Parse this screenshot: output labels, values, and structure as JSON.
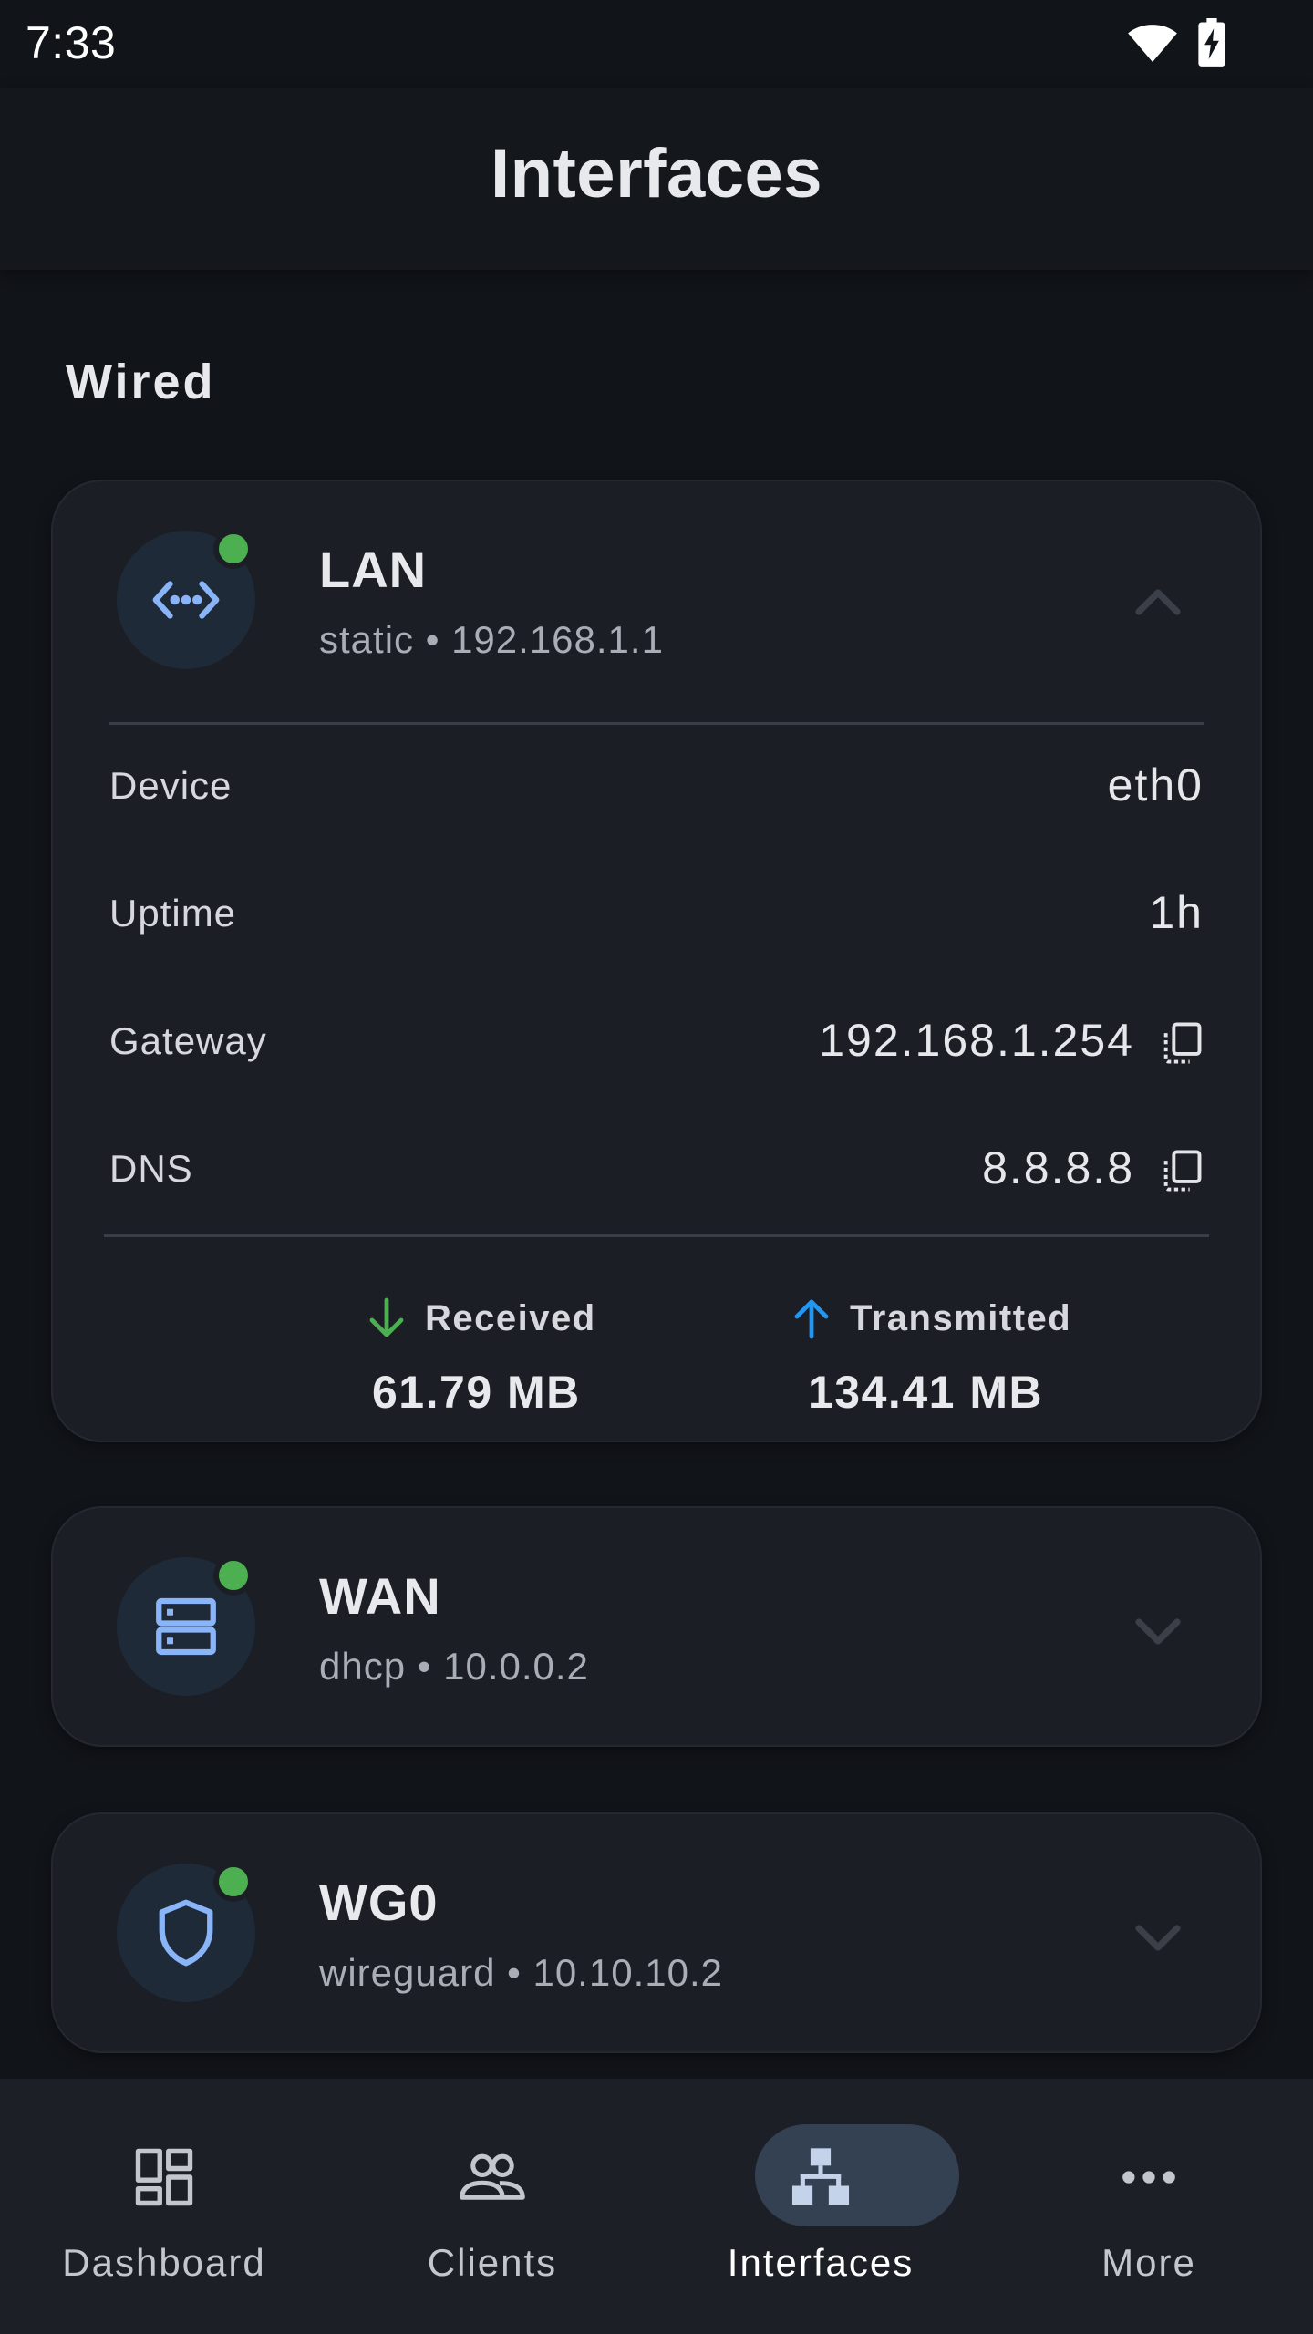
{
  "status_bar": {
    "time": "7:33",
    "wifi_icon": "wifi-icon",
    "battery_icon": "battery-charging-icon"
  },
  "app_bar": {
    "title": "Interfaces"
  },
  "section": {
    "title": "Wired"
  },
  "colors": {
    "online": "#4caf50",
    "received": "#4caf50",
    "transmitted": "#2196f3",
    "icon_accent": "#8ab4f8",
    "active_pill": "#344152"
  },
  "interfaces": [
    {
      "name": "LAN",
      "subtitle": "static • 192.168.1.1",
      "icon": "code-arrows-icon",
      "online": true,
      "expanded": true,
      "details": [
        {
          "label": "Device",
          "value": "eth0",
          "copyable": false
        },
        {
          "label": "Uptime",
          "value": "1h",
          "copyable": false
        },
        {
          "label": "Gateway",
          "value": "192.168.1.254",
          "copyable": true
        },
        {
          "label": "DNS",
          "value": "8.8.8.8",
          "copyable": true
        }
      ],
      "traffic": {
        "received_label": "Received",
        "received_value": "61.79 MB",
        "transmitted_label": "Transmitted",
        "transmitted_value": "134.41 MB"
      }
    },
    {
      "name": "WAN",
      "subtitle": "dhcp • 10.0.0.2",
      "icon": "server-icon",
      "online": true,
      "expanded": false
    },
    {
      "name": "WG0",
      "subtitle": "wireguard • 10.10.10.2",
      "icon": "shield-icon",
      "online": true,
      "expanded": false
    }
  ],
  "bottom_nav": [
    {
      "label": "Dashboard",
      "icon": "dashboard-icon",
      "active": false
    },
    {
      "label": "Clients",
      "icon": "people-icon",
      "active": false
    },
    {
      "label": "Interfaces",
      "icon": "network-tree-icon",
      "active": true
    },
    {
      "label": "More",
      "icon": "more-dots-icon",
      "active": false
    }
  ]
}
